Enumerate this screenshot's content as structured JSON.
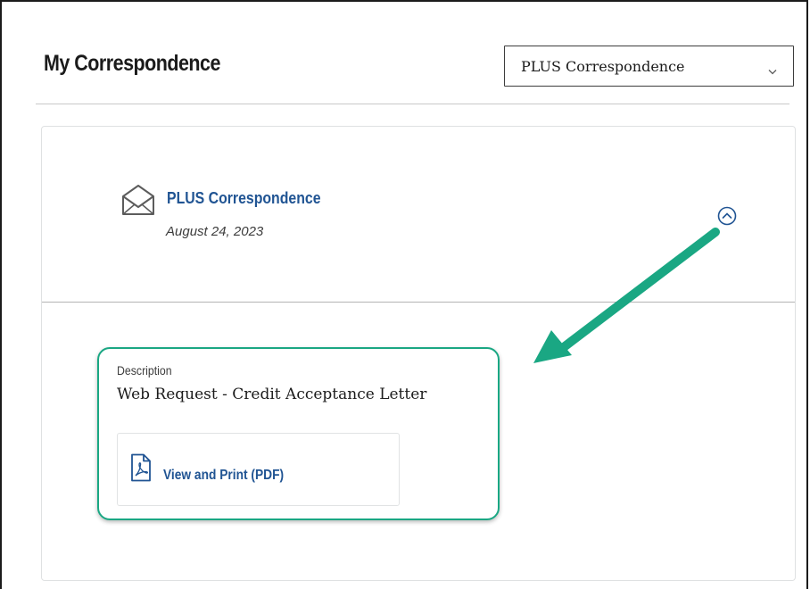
{
  "page": {
    "title": "My Correspondence"
  },
  "filter": {
    "selected": "PLUS Correspondence",
    "chevron_icon": "chevron-down-icon"
  },
  "correspondence": {
    "icon": "envelope-open-icon",
    "title": "PLUS Correspondence",
    "date": "August 24, 2023",
    "toggle_icon": "chevron-up-circle-icon",
    "description_label": "Description",
    "description": "Web Request - Credit Acceptance Letter",
    "pdf_icon": "pdf-file-icon",
    "pdf_label": "View and Print (PDF)"
  },
  "annotation": {
    "highlight_color": "#1aa783",
    "arrow_color": "#1aa783"
  },
  "colors": {
    "link": "#205493",
    "text": "#1b1b1b"
  }
}
